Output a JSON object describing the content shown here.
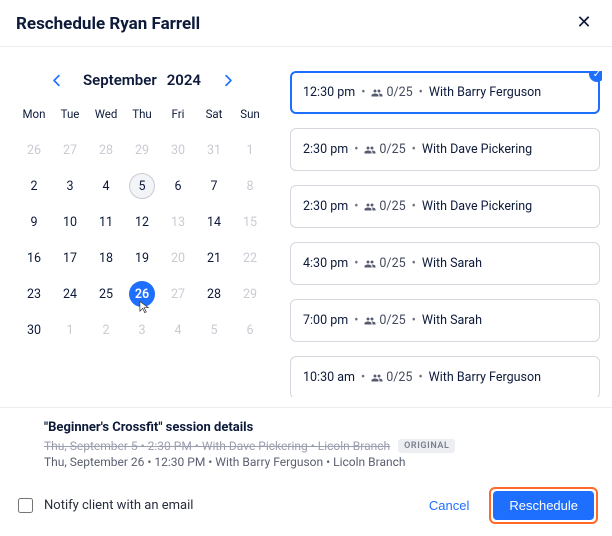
{
  "header": {
    "title": "Reschedule Ryan Farrell"
  },
  "calendar": {
    "month": "September",
    "year": "2024",
    "dow": [
      "Mon",
      "Tue",
      "Wed",
      "Thu",
      "Fri",
      "Sat",
      "Sun"
    ],
    "days": [
      {
        "n": "26",
        "muted": true
      },
      {
        "n": "27",
        "muted": true
      },
      {
        "n": "28",
        "muted": true
      },
      {
        "n": "29",
        "muted": true
      },
      {
        "n": "30",
        "muted": true
      },
      {
        "n": "31",
        "muted": true
      },
      {
        "n": "1",
        "muted": true
      },
      {
        "n": "2"
      },
      {
        "n": "3"
      },
      {
        "n": "4"
      },
      {
        "n": "5",
        "today": true
      },
      {
        "n": "6"
      },
      {
        "n": "7"
      },
      {
        "n": "8",
        "muted": true
      },
      {
        "n": "9"
      },
      {
        "n": "10"
      },
      {
        "n": "11"
      },
      {
        "n": "12"
      },
      {
        "n": "13",
        "muted": true
      },
      {
        "n": "14"
      },
      {
        "n": "15",
        "muted": true
      },
      {
        "n": "16"
      },
      {
        "n": "17"
      },
      {
        "n": "18"
      },
      {
        "n": "19"
      },
      {
        "n": "20",
        "muted": true
      },
      {
        "n": "21"
      },
      {
        "n": "22",
        "muted": true
      },
      {
        "n": "23"
      },
      {
        "n": "24"
      },
      {
        "n": "25"
      },
      {
        "n": "26",
        "selected": true
      },
      {
        "n": "27",
        "muted": true
      },
      {
        "n": "28"
      },
      {
        "n": "29",
        "muted": true
      },
      {
        "n": "30"
      },
      {
        "n": "1",
        "muted": true
      },
      {
        "n": "2",
        "muted": true
      },
      {
        "n": "3",
        "muted": true
      },
      {
        "n": "4",
        "muted": true
      },
      {
        "n": "5",
        "muted": true
      },
      {
        "n": "6",
        "muted": true
      }
    ]
  },
  "slots": [
    {
      "time": "12:30 pm",
      "capacity": "0/25",
      "with": "With Barry Ferguson",
      "selected": true
    },
    {
      "time": "2:30 pm",
      "capacity": "0/25",
      "with": "With Dave Pickering"
    },
    {
      "time": "2:30 pm",
      "capacity": "0/25",
      "with": "With Dave Pickering"
    },
    {
      "time": "4:30 pm",
      "capacity": "0/25",
      "with": "With Sarah"
    },
    {
      "time": "7:00 pm",
      "capacity": "0/25",
      "with": "With Sarah"
    },
    {
      "time": "10:30 am",
      "capacity": "0/25",
      "with": "With Barry Ferguson"
    }
  ],
  "details": {
    "title": "\"Beginner's Crossfit\" session details",
    "original_line": "Thu, September 5 • 2:30 PM • With Dave Pickering • Licoln Branch",
    "original_badge": "ORIGINAL",
    "new_line": "Thu, September 26 • 12:30 PM • With Barry Ferguson • Licoln Branch"
  },
  "footer": {
    "notify_label": "Notify client with an email",
    "cancel": "Cancel",
    "reschedule": "Reschedule"
  }
}
